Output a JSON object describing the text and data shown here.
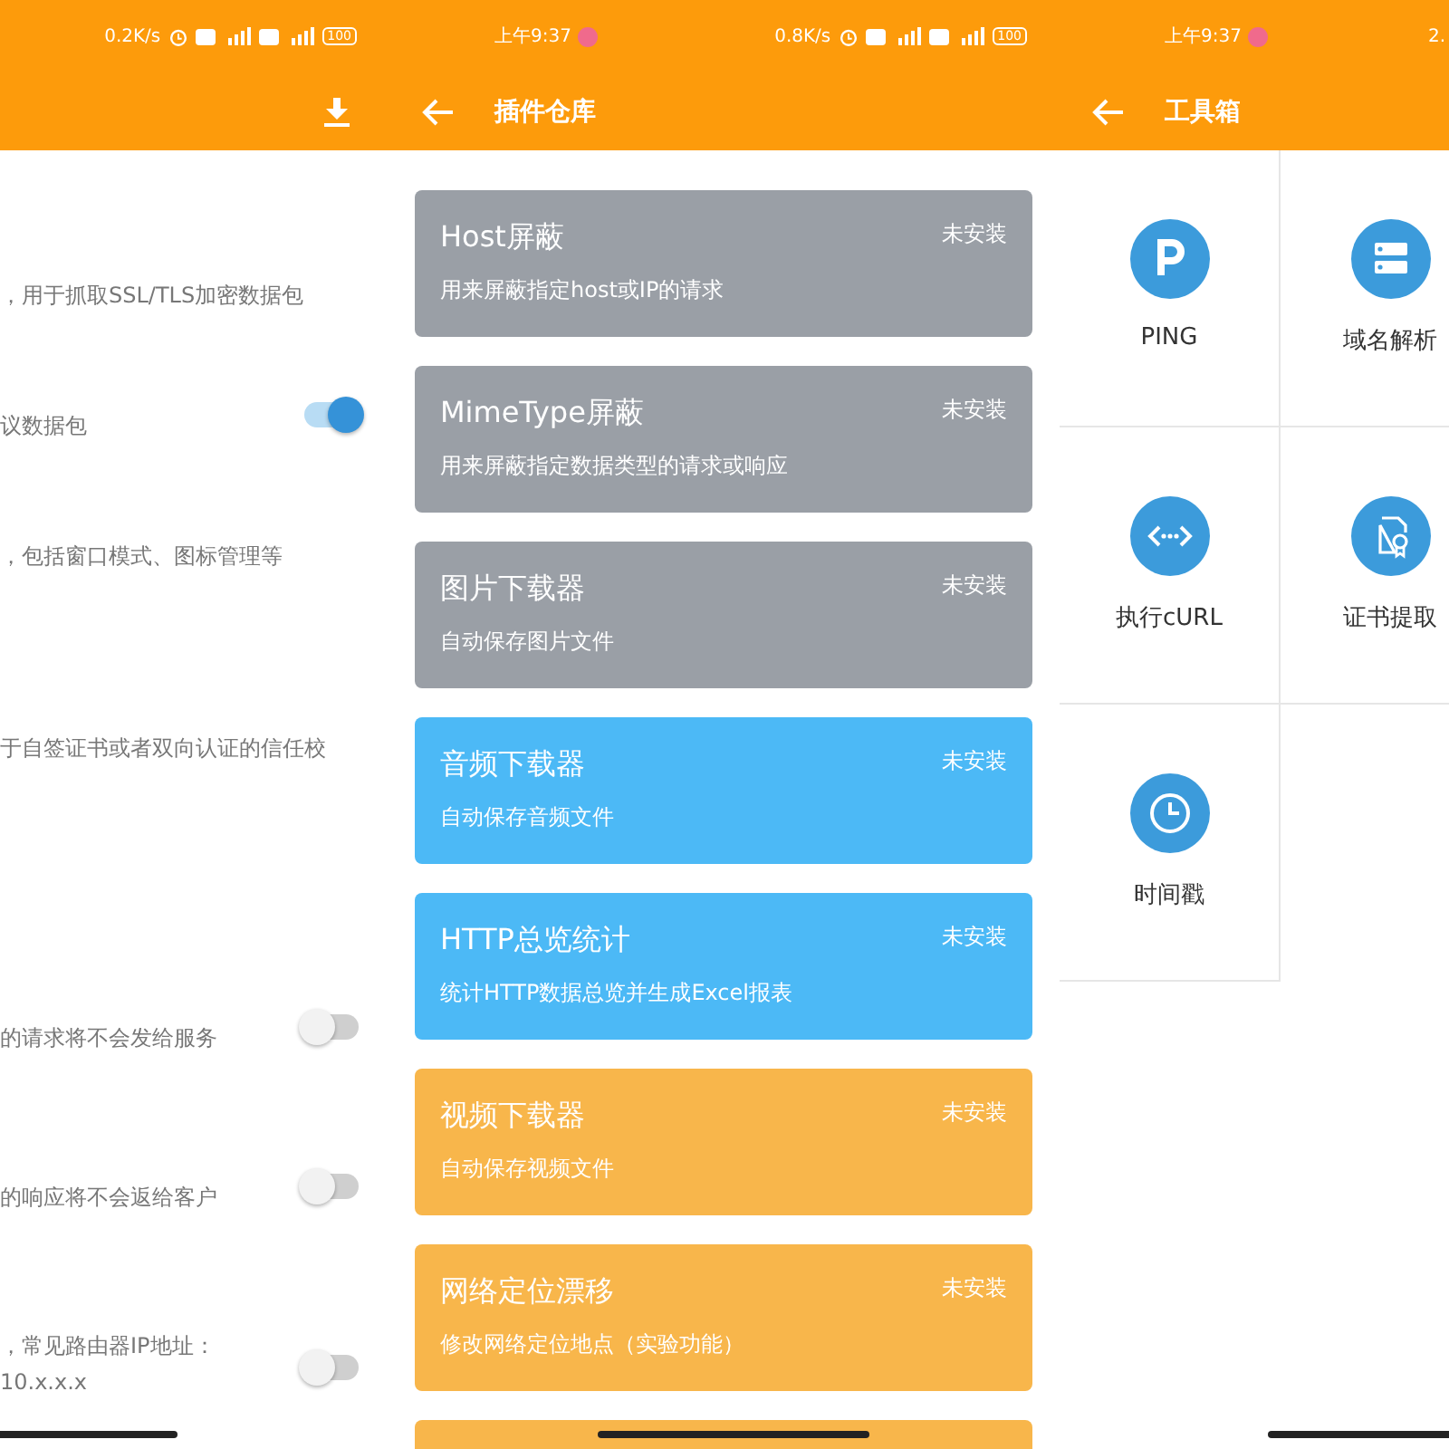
{
  "screens": [
    {
      "status": {
        "speed": "0.2K/s",
        "battery": "100"
      },
      "settings": [
        {
          "description": "，用于抓取SSL/TLS加密数据包",
          "kind": "text"
        },
        {
          "description": "议数据包",
          "kind": "toggle",
          "on": true
        },
        {
          "description": "，包括窗口模式、图标管理等",
          "kind": "text"
        },
        {
          "description": "于自签证书或者双向认证的信任校",
          "kind": "text"
        },
        {
          "description": "的请求将不会发给服务",
          "kind": "toggle",
          "on": false
        },
        {
          "description": "的响应将不会返给客户",
          "kind": "toggle",
          "on": false
        },
        {
          "description": "，常见路由器IP地址：",
          "extra": "10.x.x.x",
          "kind": "toggle",
          "on": false
        }
      ]
    },
    {
      "status": {
        "time": "上午9:37",
        "speed": "0.8K/s",
        "battery": "100"
      },
      "title": "插件仓库",
      "plugins": [
        {
          "name": "Host屏蔽",
          "description": "用来屏蔽指定host或IP的请求",
          "state": "未安装",
          "color": "#9a9fa6"
        },
        {
          "name": "MimeType屏蔽",
          "description": "用来屏蔽指定数据类型的请求或响应",
          "state": "未安装",
          "color": "#9a9fa6"
        },
        {
          "name": "图片下载器",
          "description": "自动保存图片文件",
          "state": "未安装",
          "color": "#9a9fa6"
        },
        {
          "name": "音频下载器",
          "description": "自动保存音频文件",
          "state": "未安装",
          "color": "#4cb9f6"
        },
        {
          "name": "HTTP总览统计",
          "description": "统计HTTP数据总览并生成Excel报表",
          "state": "未安装",
          "color": "#4cb9f6"
        },
        {
          "name": "视频下载器",
          "description": "自动保存视频文件",
          "state": "未安装",
          "color": "#f8b64b"
        },
        {
          "name": "网络定位漂移",
          "description": "修改网络定位地点（实验功能）",
          "state": "未安装",
          "color": "#f8b64b"
        },
        {
          "color": "#f8b64b"
        }
      ]
    },
    {
      "status": {
        "time": "上午9:37",
        "speed": "2."
      },
      "title": "工具箱",
      "tools": [
        {
          "label": "PING",
          "kind": "ping"
        },
        {
          "label": "域名解析",
          "kind": "dns"
        },
        {
          "label": "执行cURL",
          "kind": "curl"
        },
        {
          "label": "证书提取",
          "kind": "cert"
        },
        {
          "label": "时间戳",
          "kind": "clock"
        }
      ]
    }
  ]
}
